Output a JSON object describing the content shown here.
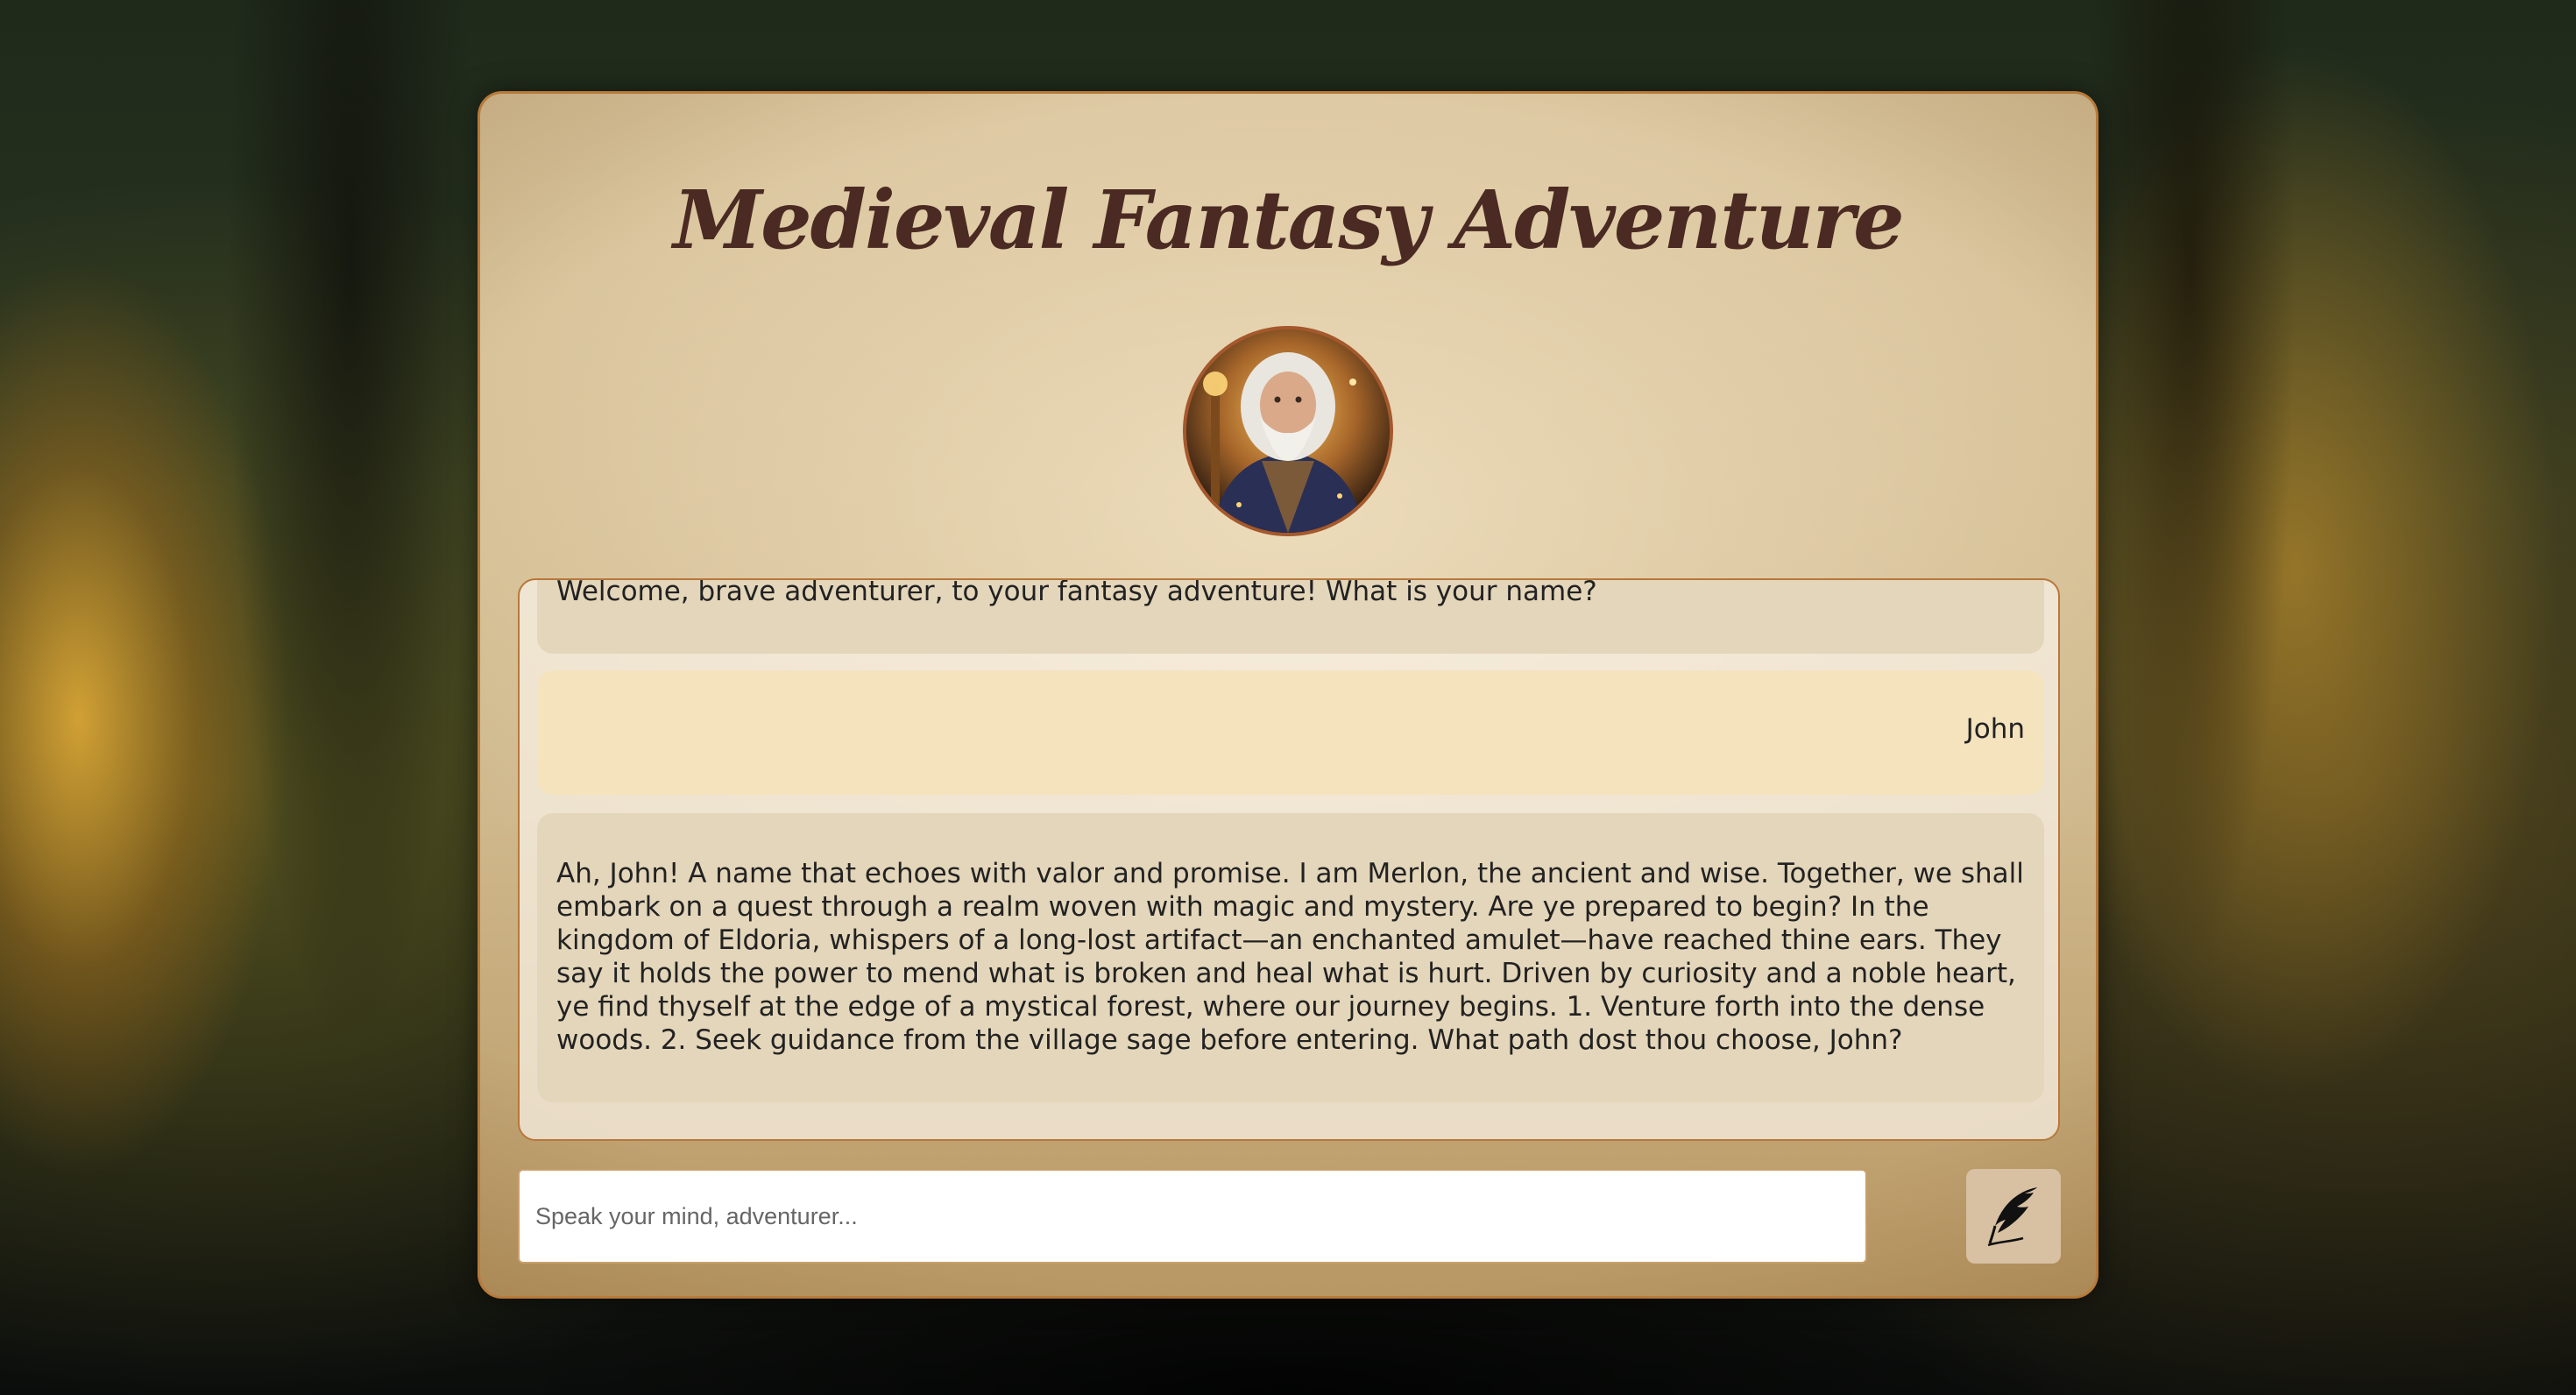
{
  "app": {
    "title": "Medieval Fantasy Adventure"
  },
  "avatar": {
    "alt": "wizard-avatar"
  },
  "chat": {
    "messages": [
      {
        "role": "bot",
        "text": "Welcome, brave adventurer, to your fantasy adventure! What is your name?"
      },
      {
        "role": "user",
        "text": "John"
      },
      {
        "role": "bot",
        "text": "Ah, John! A name that echoes with valor and promise. I am Merlon, the ancient and wise. Together, we shall embark on a quest through a realm woven with magic and mystery. Are ye prepared to begin? In the kingdom of Eldoria, whispers of a long-lost artifact—an enchanted amulet—have reached thine ears. They say it holds the power to mend what is broken and heal what is hurt. Driven by curiosity and a noble heart, ye find thyself at the edge of a mystical forest, where our journey begins. 1. Venture forth into the dense woods. 2. Seek guidance from the village sage before entering. What path dost thou choose, John?"
      }
    ]
  },
  "input": {
    "placeholder": "Speak your mind, adventurer...",
    "value": ""
  },
  "send_button": {
    "icon": "quill-icon"
  },
  "colors": {
    "panel_border": "#b87a3a",
    "title": "#4a2a22",
    "bot_bubble": "#e4d6ba",
    "user_bubble": "#f4e3bd",
    "send_button": "#d8c1a2"
  }
}
